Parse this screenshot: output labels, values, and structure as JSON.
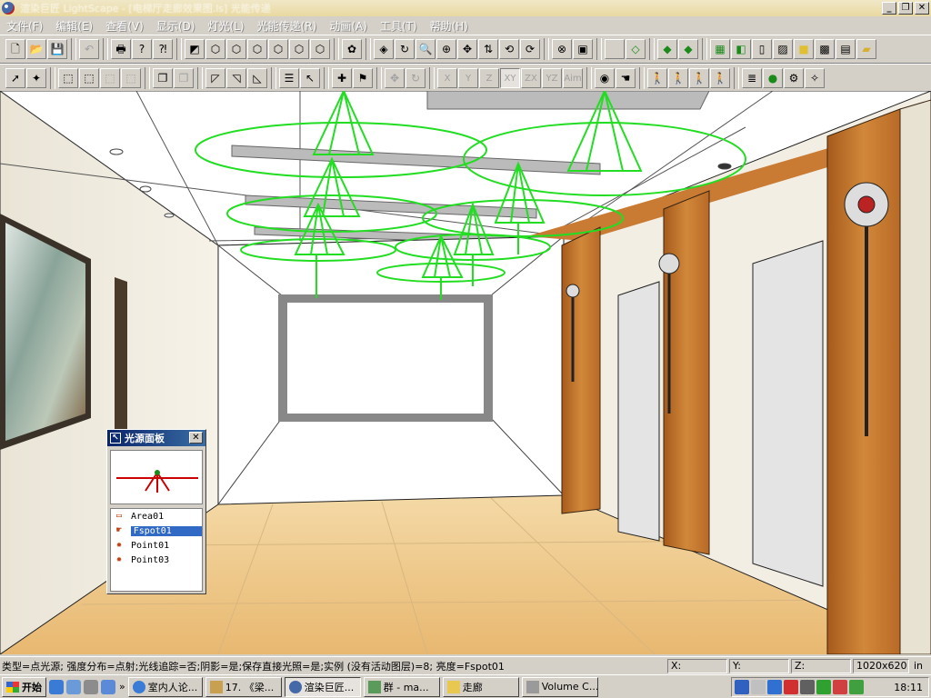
{
  "window": {
    "title": "渲染巨匠 LightScape - [电梯厅走廊效果图.ls] 光能传递",
    "minimize": "_",
    "restore": "❐",
    "close": "✕"
  },
  "menu": [
    "文件(F)",
    "编辑(E)",
    "查看(V)",
    "显示(D)",
    "灯光(L)",
    "光能传递(R)",
    "动画(A)",
    "工具(T)",
    "帮助(H)"
  ],
  "toolbar_top": [
    "new",
    "open",
    "save",
    "undo",
    "print",
    "help",
    "context-help",
    "scene",
    "cube1",
    "cube2",
    "cube3",
    "cube4",
    "cube5",
    "cube6",
    "material",
    "walk",
    "orbit",
    "zoom",
    "zoom-window",
    "pan",
    "dolly",
    "rotate",
    "refresh",
    "zoom-extents",
    "zoom-fit",
    "blank",
    "wire-box",
    "solid-green",
    "solid-green2",
    "layers",
    "mirror",
    "door",
    "hatch",
    "yellow-box",
    "checker",
    "film",
    "folder"
  ],
  "toolbar_bottom": {
    "axes": [
      "X",
      "Y",
      "Z",
      "XY",
      "ZX",
      "YZ",
      "Aim"
    ]
  },
  "light_panel": {
    "title": "光源面板",
    "close": "✕",
    "items": [
      {
        "name": "Area01",
        "icon": "area-light-icon",
        "selected": false
      },
      {
        "name": "Fspot01",
        "icon": "spot-light-icon",
        "selected": true
      },
      {
        "name": "Point01",
        "icon": "point-light-icon",
        "selected": false
      },
      {
        "name": "Point03",
        "icon": "point-light-icon",
        "selected": false
      }
    ]
  },
  "status": {
    "text": "类型=点光源; 强度分布=点射;光线追踪=否;阴影=是;保存直接光照=是;实例 (没有活动图层)=8; 亮度=Fspot01",
    "x_label": "X:",
    "y_label": "Y:",
    "z_label": "Z:",
    "resolution": "1020x620",
    "unit": "in"
  },
  "taskbar": {
    "start": "开始",
    "tasks": [
      {
        "label": "室内人论...",
        "active": false
      },
      {
        "label": "17. 《梁...",
        "active": false
      },
      {
        "label": "渲染巨匠...",
        "active": true
      },
      {
        "label": "群 - ma...",
        "active": false
      },
      {
        "label": "走廊",
        "active": false
      },
      {
        "label": "Volume C...",
        "active": false
      }
    ],
    "overflow": "»",
    "clock": "18:11"
  },
  "colors": {
    "wireframe_green": "#22dd22",
    "wood": "#c57a2e",
    "floor": "#efc98a",
    "selection": "#316ac5"
  }
}
